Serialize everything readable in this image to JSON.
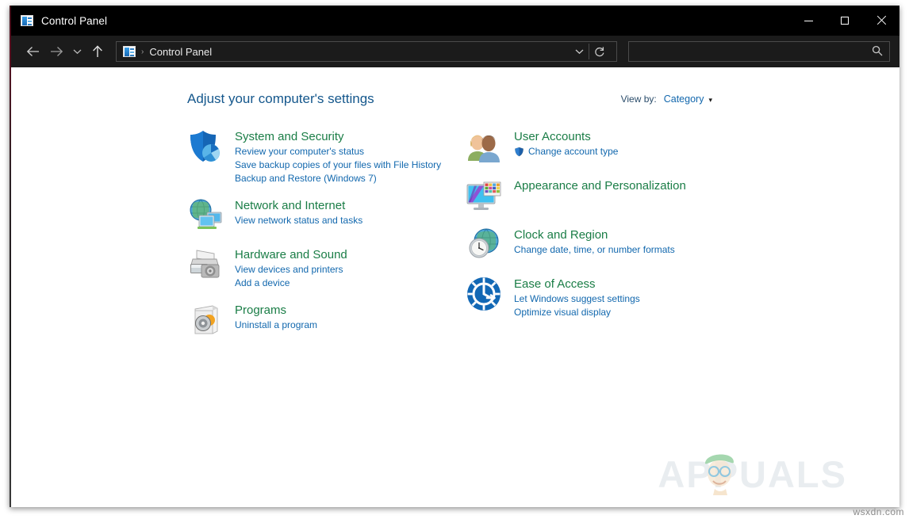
{
  "window": {
    "title": "Control Panel",
    "icon": "control-panel-icon",
    "controls": {
      "minimize": "—",
      "maximize": "□",
      "close": "✕"
    }
  },
  "navbar": {
    "back": "back-arrow",
    "forward": "forward-arrow",
    "recent": "chevron-down",
    "up": "up-arrow",
    "breadcrumb": {
      "icon": "control-panel-icon",
      "separator": "›",
      "path": "Control Panel"
    },
    "dropdown": "⌄",
    "refresh": "↻",
    "search": {
      "value": "",
      "placeholder": "",
      "icon": "search-icon"
    }
  },
  "main": {
    "page_title": "Adjust your computer's settings",
    "view_by": {
      "label": "View by:",
      "value": "Category",
      "caret": "▾"
    },
    "columns": {
      "left": [
        {
          "icon": "shield-chart-icon",
          "title": "System and Security",
          "links": [
            "Review your computer's status",
            "Save backup copies of your files with File History",
            "Backup and Restore (Windows 7)"
          ]
        },
        {
          "icon": "globe-monitors-icon",
          "title": "Network and Internet",
          "links": [
            "View network status and tasks"
          ]
        },
        {
          "icon": "printer-icon",
          "title": "Hardware and Sound",
          "links": [
            "View devices and printers",
            "Add a device"
          ]
        },
        {
          "icon": "program-disc-icon",
          "title": "Programs",
          "links": [
            "Uninstall a program"
          ]
        }
      ],
      "right": [
        {
          "icon": "user-accounts-icon",
          "title": "User Accounts",
          "links": [
            "Change account type"
          ],
          "shield_on_first_link": true
        },
        {
          "icon": "monitor-palette-icon",
          "title": "Appearance and Personalization",
          "links": []
        },
        {
          "icon": "clock-globe-icon",
          "title": "Clock and Region",
          "links": [
            "Change date, time, or number formats"
          ]
        },
        {
          "icon": "ease-of-access-icon",
          "title": "Ease of Access",
          "links": [
            "Let Windows suggest settings",
            "Optimize visual display"
          ]
        }
      ]
    }
  },
  "watermark": {
    "brand": "APPUALS",
    "site": "wsxdn.com"
  },
  "colors": {
    "titlebar_bg": "#000000",
    "navbar_bg": "#1b1b1b",
    "content_bg": "#ffffff",
    "category_title": "#1a7d46",
    "link": "#1268ae",
    "page_title": "#14578c"
  }
}
